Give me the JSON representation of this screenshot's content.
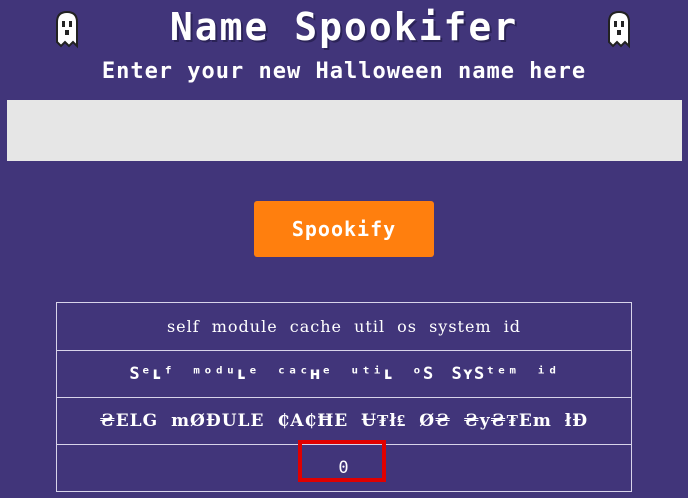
{
  "header": {
    "title": "Name Spookifer",
    "subtitle": "Enter your new Halloween name here"
  },
  "input": {
    "value": "",
    "placeholder": ""
  },
  "button": {
    "label": "Spookify",
    "color": "#ff7f0e"
  },
  "results": [
    "self module cache util os system id",
    "Sᵉʟᶠ ᵐᵒᵈᵘʟᵉ ᶜᵃᶜʜᵉ ᵘᵗⁱʟ ᵒS SʏSᵗᵉᵐ ⁱᵈ",
    "₴ELG mØĐULE ₵A₵ĦE Ʉ₮ł₤ Ø₴ ₴y₴₮Em łĐ",
    "0"
  ],
  "colors": {
    "background": "#41357a",
    "highlight": "#e00000"
  }
}
